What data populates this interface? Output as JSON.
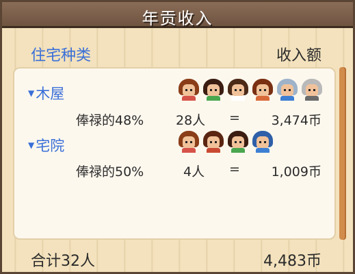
{
  "window": {
    "title": "年贡收入"
  },
  "header": {
    "left": "住宅种类",
    "right": "收入额"
  },
  "rows": [
    {
      "category": "木屋",
      "rate": "俸禄的48%",
      "people": "28人",
      "eq": "=",
      "amount": "3,474币",
      "faces": [
        {
          "hair": "#8a3d18",
          "shirt": "#d6534a"
        },
        {
          "hair": "#3b1d12",
          "shirt": "#4aa74f"
        },
        {
          "hair": "#4b2a18",
          "shirt": "#ffffff"
        },
        {
          "hair": "#7a2f12",
          "shirt": "#d86a3a"
        },
        {
          "hair": "#9eb3c9",
          "shirt": "#3e7fd3"
        },
        {
          "hair": "#b9b9b9",
          "shirt": "#6b6b6b"
        }
      ]
    },
    {
      "category": "宅院",
      "rate": "俸禄的50%",
      "people": "4人",
      "eq": "=",
      "amount": "1,009币",
      "faces": [
        {
          "hair": "#8a3d18",
          "shirt": "#d6534a"
        },
        {
          "hair": "#5a2612",
          "shirt": "#c94a33"
        },
        {
          "hair": "#3b1d12",
          "shirt": "#4aa74f"
        },
        {
          "hair": "#2e5fa8",
          "shirt": "#3e7fd3"
        }
      ]
    }
  ],
  "footer": {
    "total_people": "合计32人",
    "total_amount": "4,483币"
  },
  "colors": {
    "accent_blue": "#3a6fd8",
    "titlebar": "#6f5441",
    "background": "#f3e2bd",
    "scroll_thumb": "#d18b4b"
  }
}
